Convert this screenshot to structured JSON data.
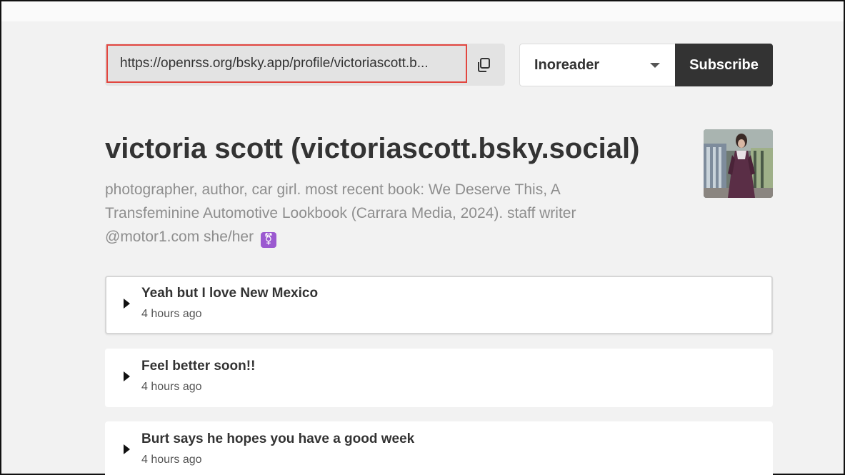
{
  "feed_url": {
    "value": "https://openrss.org/bsky.app/profile/victoriascott.b...",
    "copy_icon": "copy-icon"
  },
  "reader": {
    "selected": "Inoreader",
    "subscribe_label": "Subscribe"
  },
  "profile": {
    "title": "victoria scott (victoriascott.bsky.social)",
    "bio": "photographer, author, car girl. most recent book: We Deserve This, A Transfeminine Automotive Lookbook (Carrara Media, 2024). staff writer @motor1.com she/her",
    "bio_emoji": "⚧",
    "avatar_icon": "avatar-photo"
  },
  "posts": [
    {
      "title": "Yeah but I love New Mexico",
      "time": "4 hours ago"
    },
    {
      "title": "Feel better soon!!",
      "time": "4 hours ago"
    },
    {
      "title": "Burt says he hopes you have a good week",
      "time": "4 hours ago"
    }
  ],
  "colors": {
    "background": "#f2f2f2",
    "highlight_border": "#e2463f",
    "subscribe_bg": "#333333",
    "emoji_badge": "#9b59d0"
  }
}
